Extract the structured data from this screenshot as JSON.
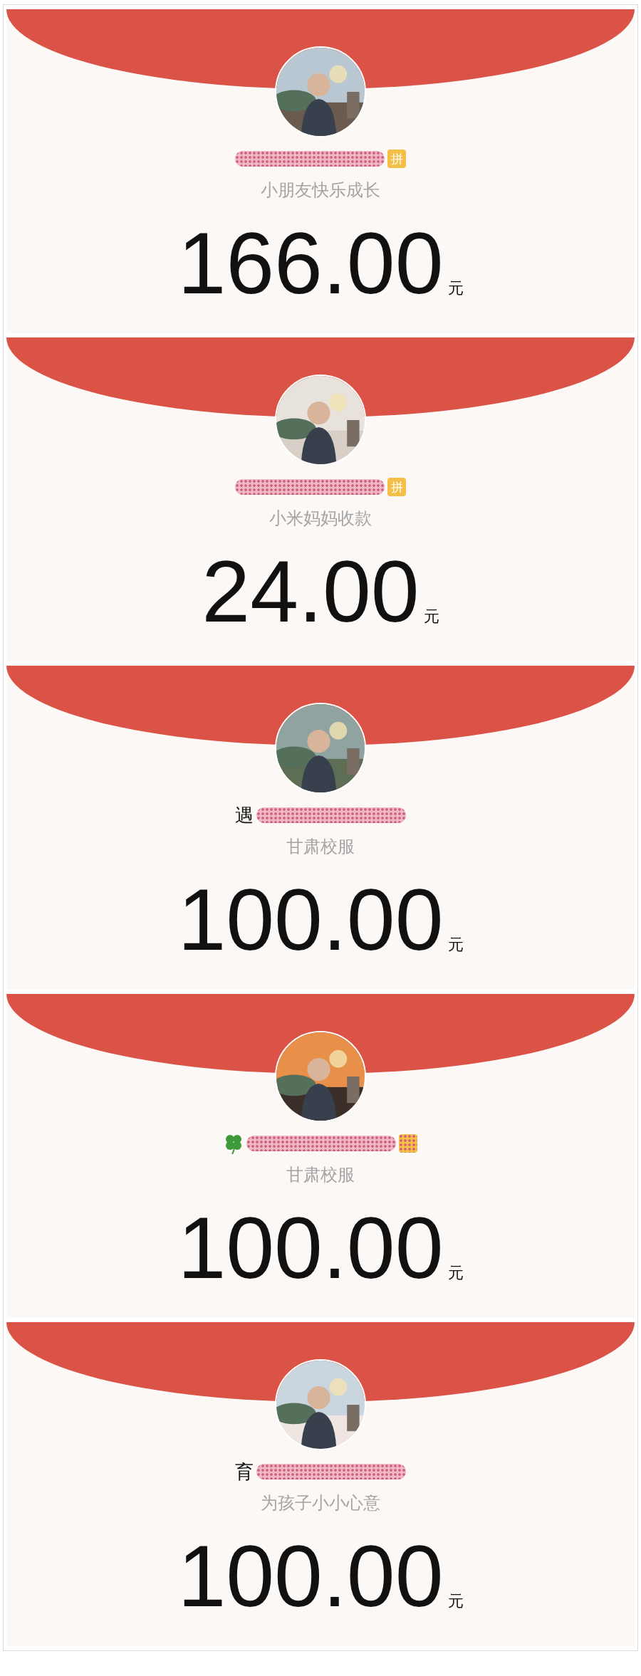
{
  "packets": [
    {
      "badge": {
        "text": "拼"
      },
      "note": "小朋友快乐成长",
      "amount": "166.00",
      "unit": "元"
    },
    {
      "badge": {
        "text": "拼"
      },
      "note": "小米妈妈收款",
      "amount": "24.00",
      "unit": "元"
    },
    {
      "name_visible": "遇",
      "note": "甘肃校服",
      "amount": "100.00",
      "unit": "元"
    },
    {
      "clover": true,
      "badge": {
        "covered": true
      },
      "note": "甘肃校服",
      "amount": "100.00",
      "unit": "元"
    },
    {
      "name_visible": "育",
      "note": "为孩子小小心意",
      "amount": "100.00",
      "unit": "元"
    }
  ]
}
